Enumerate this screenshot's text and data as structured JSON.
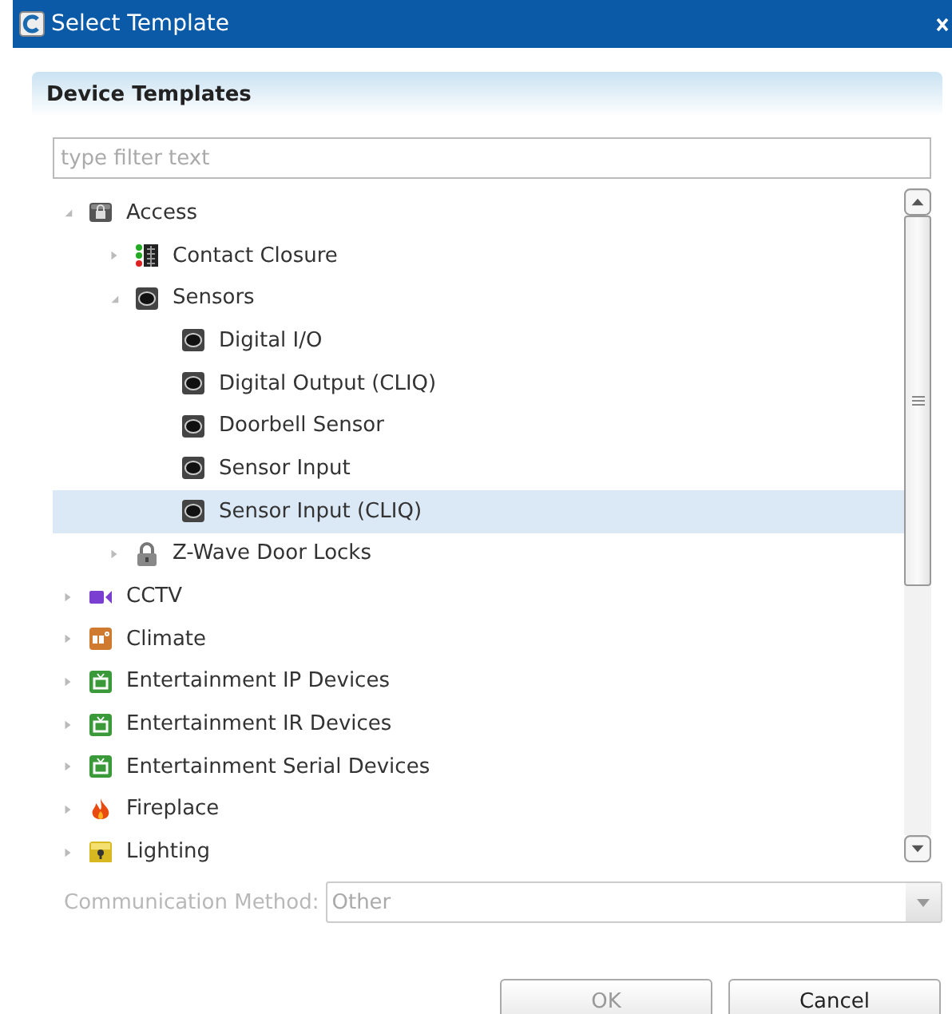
{
  "window": {
    "title": "Select Template"
  },
  "panel": {
    "title": "Device Templates"
  },
  "filter": {
    "placeholder": "type filter text"
  },
  "tree": [
    {
      "label": "Access",
      "kind": "lockbox",
      "expanded": true,
      "selected": false,
      "children": [
        {
          "label": "Contact Closure",
          "kind": "contact",
          "expanded": false,
          "selected": false
        },
        {
          "label": "Sensors",
          "kind": "sensor",
          "expanded": true,
          "selected": false,
          "children": [
            {
              "label": "Digital I/O",
              "kind": "sensor",
              "selected": false
            },
            {
              "label": "Digital Output (CLIQ)",
              "kind": "sensor",
              "selected": false
            },
            {
              "label": "Doorbell Sensor",
              "kind": "sensor",
              "selected": false
            },
            {
              "label": "Sensor Input",
              "kind": "sensor",
              "selected": false
            },
            {
              "label": "Sensor Input (CLIQ)",
              "kind": "sensor",
              "selected": true
            }
          ]
        },
        {
          "label": "Z-Wave Door Locks",
          "kind": "padlock",
          "expanded": false,
          "selected": false
        }
      ]
    },
    {
      "label": "CCTV",
      "kind": "camera",
      "expanded": false,
      "selected": false
    },
    {
      "label": "Climate",
      "kind": "thermostat",
      "expanded": false,
      "selected": false
    },
    {
      "label": "Entertainment IP Devices",
      "kind": "tv",
      "expanded": false,
      "selected": false
    },
    {
      "label": "Entertainment IR Devices",
      "kind": "tv",
      "expanded": false,
      "selected": false
    },
    {
      "label": "Entertainment Serial Devices",
      "kind": "tv",
      "expanded": false,
      "selected": false
    },
    {
      "label": "Fireplace",
      "kind": "flame",
      "expanded": false,
      "selected": false
    },
    {
      "label": "Lighting",
      "kind": "bulb",
      "expanded": false,
      "selected": false
    }
  ],
  "communication": {
    "label": "Communication Method:",
    "value": "Other",
    "disabled": true
  },
  "buttons": [
    {
      "label": "OK",
      "disabled": true
    },
    {
      "label": "Cancel",
      "disabled": false
    }
  ]
}
